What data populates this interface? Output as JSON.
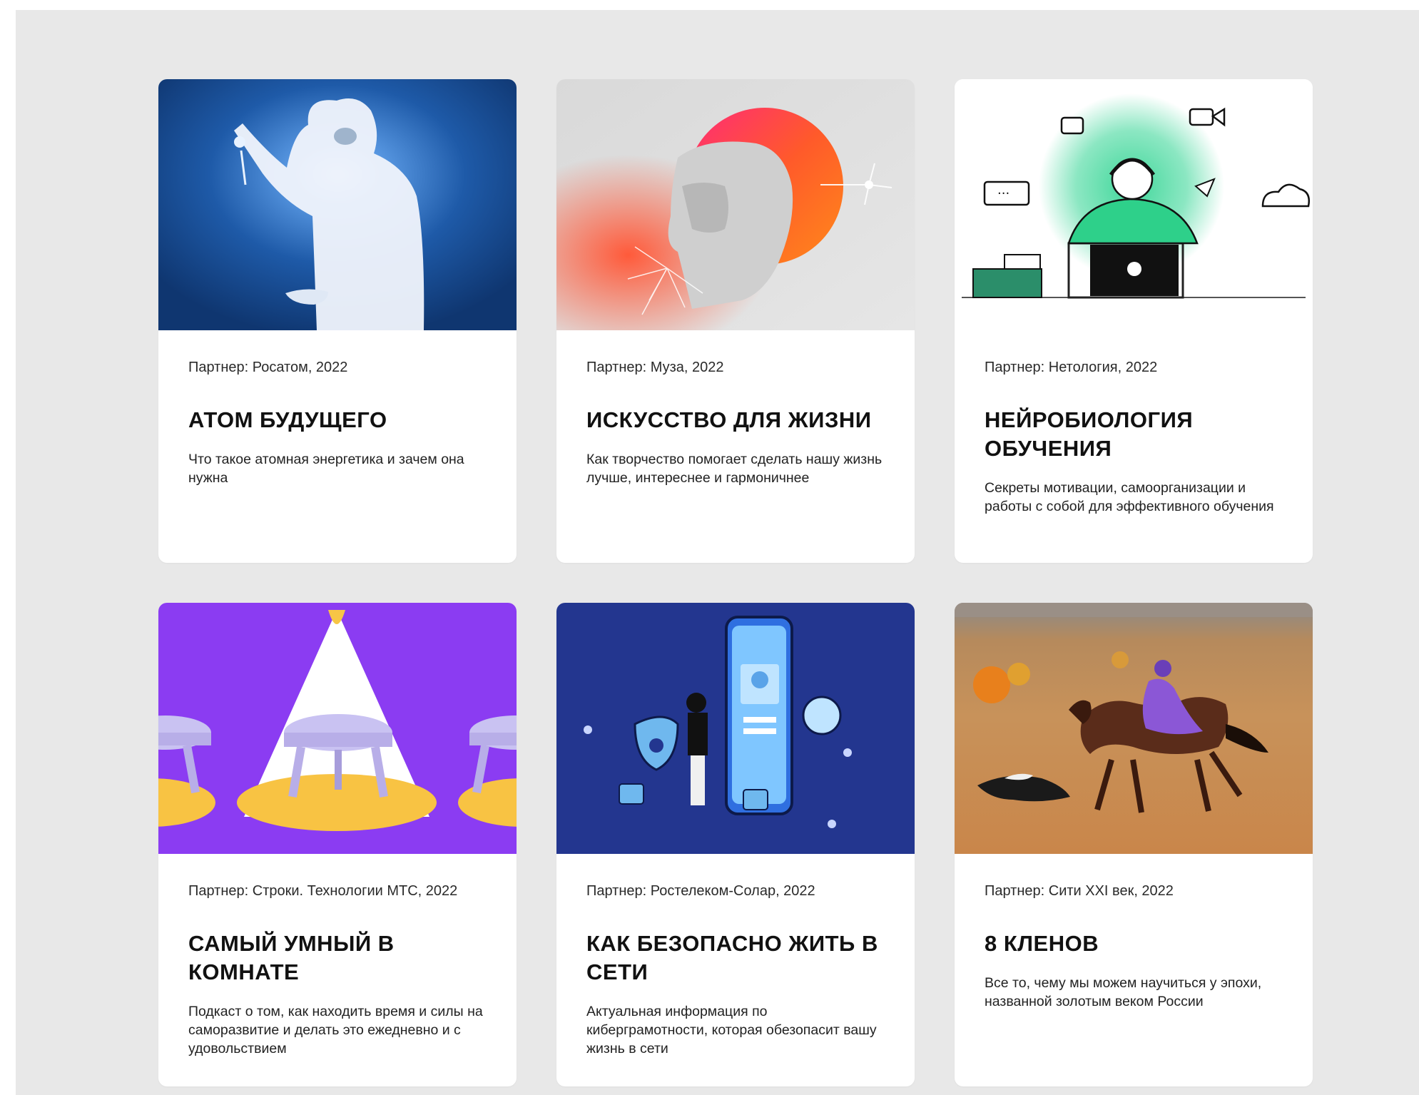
{
  "colors": {
    "page_bg": "#e8e8e8",
    "card_bg": "#ffffff"
  },
  "cards": [
    {
      "partner": "Партнер: Росатом, 2022",
      "title": "АТОМ БУДУЩЕГО",
      "description": "Что такое атомная энергетика и зачем она нужна",
      "image": "scientist-in-protective-suit-illustration"
    },
    {
      "partner": "Партнер: Муза, 2022",
      "title": "ИСКУССТВО ДЛЯ ЖИЗНИ",
      "description": "Как творчество помогает сделать нашу жизнь лучше, интереснее и гармоничнее",
      "image": "antique-sculpture-head-illustration"
    },
    {
      "partner": "Партнер: Нетология, 2022",
      "title": "НЕЙРОБИОЛОГИЯ ОБУЧЕНИЯ",
      "description": "Секреты мотивации, самоорганизации и работы с собой для эффективного обучения",
      "image": "student-with-laptop-illustration"
    },
    {
      "partner": "Партнер: Строки. Технологии МТС, 2022",
      "title": "САМЫЙ УМНЫЙ В КОМНАТЕ",
      "description": "Подкаст о том, как находить время и силы на саморазвитие и делать это ежедневно и с удовольствием",
      "image": "stools-under-spotlight-illustration"
    },
    {
      "partner": "Партнер: Ростелеком-Солар, 2022",
      "title": "КАК БЕЗОПАСНО ЖИТЬ В СЕТИ",
      "description": "Актуальная информация по киберграмотности, которая обезопасит вашу жизнь в сети",
      "image": "cyber-security-phone-illustration"
    },
    {
      "partner": "Партнер: Сити XXI век, 2022",
      "title": "8 КЛЕНОВ",
      "description": "Все то, чему мы можем научиться у эпохи, названной золотым веком России",
      "image": "horse-rider-in-autumn-field-photo"
    }
  ]
}
